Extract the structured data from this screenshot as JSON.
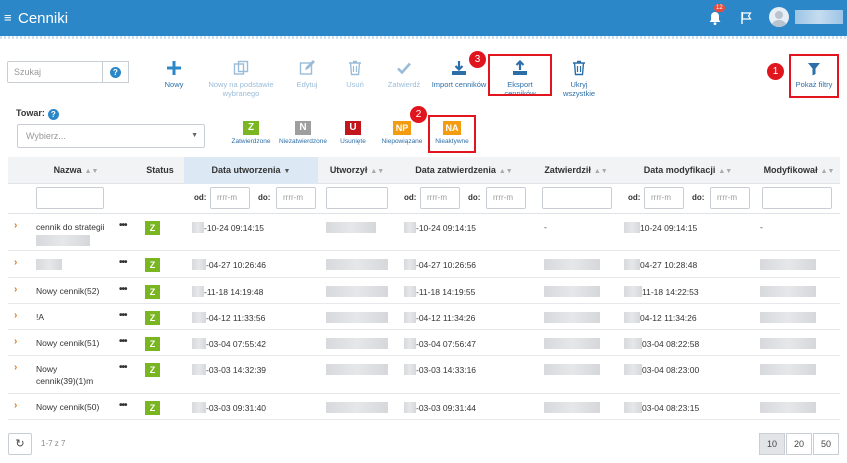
{
  "app": {
    "title": "Cenniki",
    "notifications_count": "12"
  },
  "search": {
    "placeholder": "Szukaj",
    "help": "?"
  },
  "toolbar": [
    {
      "key": "nowy",
      "label": "Nowy",
      "icon": "plus-icon",
      "enabled": true
    },
    {
      "key": "nowy-podstawie",
      "label": "Nowy na podstawie wybranego",
      "icon": "copy-icon",
      "enabled": false
    },
    {
      "key": "edytuj",
      "label": "Edytuj",
      "icon": "edit-icon",
      "enabled": false
    },
    {
      "key": "usun",
      "label": "Usuń",
      "icon": "trash-icon",
      "enabled": false
    },
    {
      "key": "zatwierdz",
      "label": "Zatwierdź",
      "icon": "check-icon",
      "enabled": false
    },
    {
      "key": "import",
      "label": "Import cenników",
      "icon": "download-icon",
      "enabled": true
    },
    {
      "key": "eksport",
      "label": "Eksport cenników",
      "icon": "upload-icon",
      "enabled": true
    },
    {
      "key": "ukryj",
      "label": "Ukryj wszystkie",
      "icon": "trash-icon",
      "enabled": true
    }
  ],
  "filters_button": {
    "label": "Pokaż filtry"
  },
  "markers": [
    "1",
    "2",
    "3"
  ],
  "towar": {
    "label": "Towar:",
    "help": "?",
    "placeholder": "Wybierz..."
  },
  "status_filters": [
    {
      "code": "Z",
      "label": "Zatwierdzone",
      "color": "#79b622"
    },
    {
      "code": "N",
      "label": "Niezatwierdzone",
      "color": "#9e9e9e"
    },
    {
      "code": "U",
      "label": "Usunięte",
      "color": "#c0161c"
    },
    {
      "code": "NP",
      "label": "Niepowiązane",
      "color": "#f39c12"
    },
    {
      "code": "NA",
      "label": "Nieaktywne",
      "color": "#f39c12"
    }
  ],
  "columns": {
    "nazwa": "Nazwa",
    "status": "Status",
    "data_utworzenia": "Data utworzenia",
    "utworzyl": "Utworzył",
    "data_zatwierdzenia": "Data zatwierdzenia",
    "zatwierdzil": "Zatwierdził",
    "data_modyfikacji": "Data modyfikacji",
    "modyfikowal": "Modyfikował"
  },
  "date_filter": {
    "od": "od:",
    "do": "do:",
    "placeholder": "rrrr-m"
  },
  "rows": [
    {
      "name": "cennik do strategii",
      "status": "Z",
      "created": "-10-24 09:14:15",
      "approved": "-10-24 09:14:15",
      "approver": "-",
      "modified": "10-24 09:14:15",
      "modifier": "-"
    },
    {
      "name": "",
      "status": "Z",
      "created": "-04-27 10:26:46",
      "approved": "-04-27 10:26:56",
      "approver": "",
      "modified": "04-27 10:28:48",
      "modifier": ""
    },
    {
      "name": "Nowy cennik(52)",
      "status": "Z",
      "created": "-11-18 14:19:48",
      "approved": "-11-18 14:19:55",
      "approver": "",
      "modified": "11-18 14:22:53",
      "modifier": ""
    },
    {
      "name": "!A",
      "status": "Z",
      "created": "-04-12 11:33:56",
      "approved": "-04-12 11:34:26",
      "approver": "",
      "modified": "04-12 11:34:26",
      "modifier": ""
    },
    {
      "name": "Nowy cennik(51)",
      "status": "Z",
      "created": "-03-04 07:55:42",
      "approved": "-03-04 07:56:47",
      "approver": "",
      "modified": "03-04 08:22:58",
      "modifier": ""
    },
    {
      "name": "Nowy cennik(39)(1)m",
      "status": "Z",
      "created": "-03-03 14:32:39",
      "approved": "-03-03 14:33:16",
      "approver": "",
      "modified": "03-04 08:23:00",
      "modifier": ""
    },
    {
      "name": "Nowy cennik(50)",
      "status": "Z",
      "created": "-03-03 09:31:40",
      "approved": "-03-03 09:31:44",
      "approver": "",
      "modified": "03-04 08:23:15",
      "modifier": ""
    }
  ],
  "footer": {
    "count": "1-7 z 7",
    "page_sizes": [
      "10",
      "20",
      "50"
    ],
    "active_page_size": "10"
  }
}
